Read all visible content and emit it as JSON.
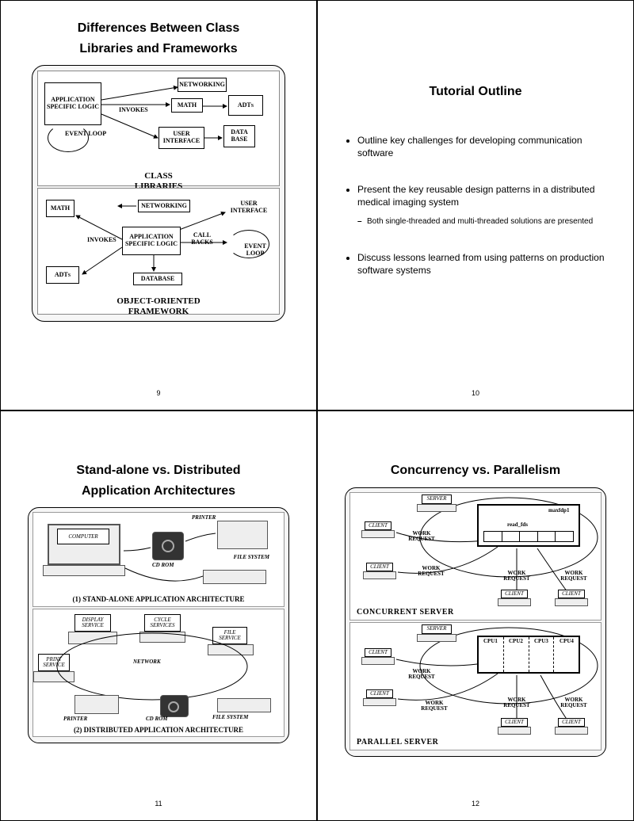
{
  "slides": {
    "s9": {
      "title_l1": "Differences Between Class",
      "title_l2": "Libraries and Frameworks",
      "page": "9",
      "topcap_l1": "CLASS",
      "topcap_l2": "LIBRARIES",
      "botcap_l1": "OBJECT-ORIENTED",
      "botcap_l2": "FRAMEWORK",
      "boxes": {
        "applogic": "APPLICATION SPECIFIC LOGIC",
        "eventloop": "EVENT LOOP",
        "networking": "NETWORKING",
        "math": "MATH",
        "adts": "ADTs",
        "userif": "USER INTERFACE",
        "database": "DATA BASE",
        "database2": "DATABASE",
        "invokes": "INVOKES",
        "callbacks": "CALL BACKS",
        "ui2": "USER INTERFACE"
      }
    },
    "s10": {
      "title": "Tutorial Outline",
      "page": "10",
      "b1": "Outline key challenges for developing communication software",
      "b2": "Present the key reusable design patterns in a distributed medical imaging system",
      "b2s1": "Both single-threaded and multi-threaded solutions are presented",
      "b3": "Discuss lessons learned from using patterns on production software systems"
    },
    "s11": {
      "title_l1": "Stand-alone vs. Distributed",
      "title_l2": "Application Architectures",
      "page": "11",
      "cap1": "(1) STAND-ALONE APPLICATION ARCHITECTURE",
      "cap2": "(2) DISTRIBUTED APPLICATION ARCHITECTURE",
      "labels": {
        "printer": "PRINTER",
        "computer": "COMPUTER",
        "cdrom": "CD ROM",
        "filesystem": "FILE SYSTEM",
        "display": "DISPLAY SERVICE",
        "cycle": "CYCLE SERVICES",
        "file": "FILE SERVICE",
        "print": "PRINT SERVICE",
        "network": "NETWORK"
      }
    },
    "s12": {
      "title": "Concurrency vs. Parallelism",
      "page": "12",
      "cap1": "CONCURRENT SERVER",
      "cap2": "PARALLEL SERVER",
      "labels": {
        "server": "SERVER",
        "client": "CLIENT",
        "work": "WORK REQUEST",
        "maxfdp1": "maxfdp1",
        "readfds": "read_fds",
        "cpu1": "CPU1",
        "cpu2": "CPU2",
        "cpu3": "CPU3",
        "cpu4": "CPU4"
      }
    }
  }
}
